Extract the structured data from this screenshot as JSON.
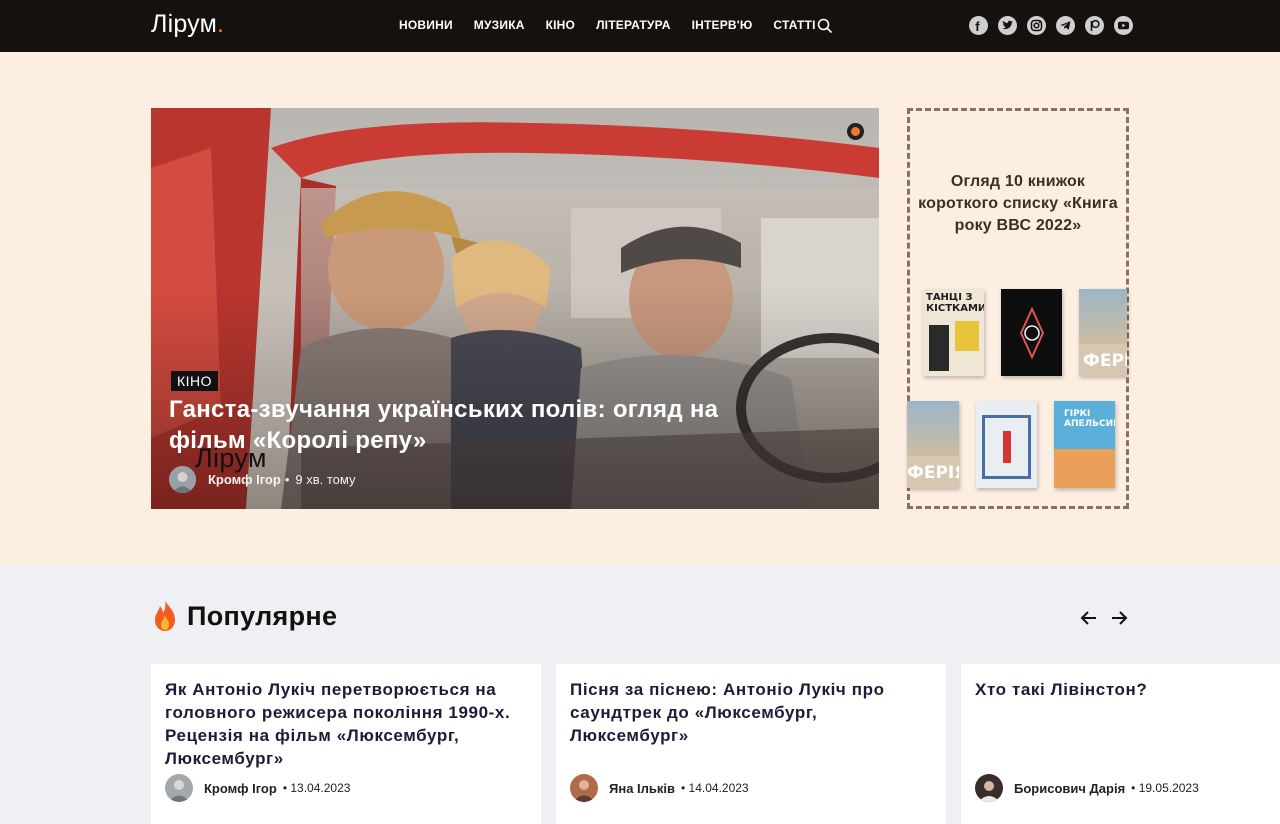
{
  "header": {
    "logo": "Лірум",
    "logo_dot": ".",
    "nav": [
      "НОВИНИ",
      "МУЗИКА",
      "КІНО",
      "ЛІТЕРАТУРА",
      "ІНТЕРВ'Ю",
      "СТАТТІ"
    ],
    "socials": [
      "facebook-icon",
      "twitter-icon",
      "instagram-icon",
      "telegram-icon",
      "patreon-icon",
      "youtube-icon"
    ]
  },
  "hero": {
    "category": "КІНО",
    "title": "Ганста-звучання українських полів: огляд на фільм «Королі репу»",
    "watermark": "Лірум",
    "author": "Кромф Ігор",
    "separator": "•",
    "time": "9 хв. тому"
  },
  "promo": {
    "title": "Огляд 10 книжок короткого списку «Книга року ВВС 2022»",
    "books": [
      {
        "label": "ТАНЦІ З КІСТКАМИ"
      },
      {
        "label": ""
      },
      {
        "label": "ФЕРІ"
      },
      {
        "label": "ФЕРІЯ"
      },
      {
        "label": ""
      },
      {
        "label": "ГІРКІ АПЕЛЬСИНИ"
      }
    ]
  },
  "popular": {
    "title": "Популярне",
    "cards": [
      {
        "title": "Як Антоніо Лукіч перетворюється на головного режисера покоління 1990-х. Рецензія на фільм «Люксембург, Люксембург»",
        "author": "Кромф Ігор",
        "date": "• 13.04.2023"
      },
      {
        "title": "Пісня за піснею: Антоніо Лукіч про саундтрек до «Люксембург, Люксембург»",
        "author": "Яна Ільків",
        "date": "• 14.04.2023"
      },
      {
        "title": "Хто такі Лівінстон?",
        "author": "Борисович Дарія",
        "date": "• 19.05.2023"
      }
    ]
  },
  "colors": {
    "header_bg": "#16110e",
    "accent": "#f07a2a",
    "hero_band": "#fdeee2",
    "section_bg": "#eef0f3"
  }
}
